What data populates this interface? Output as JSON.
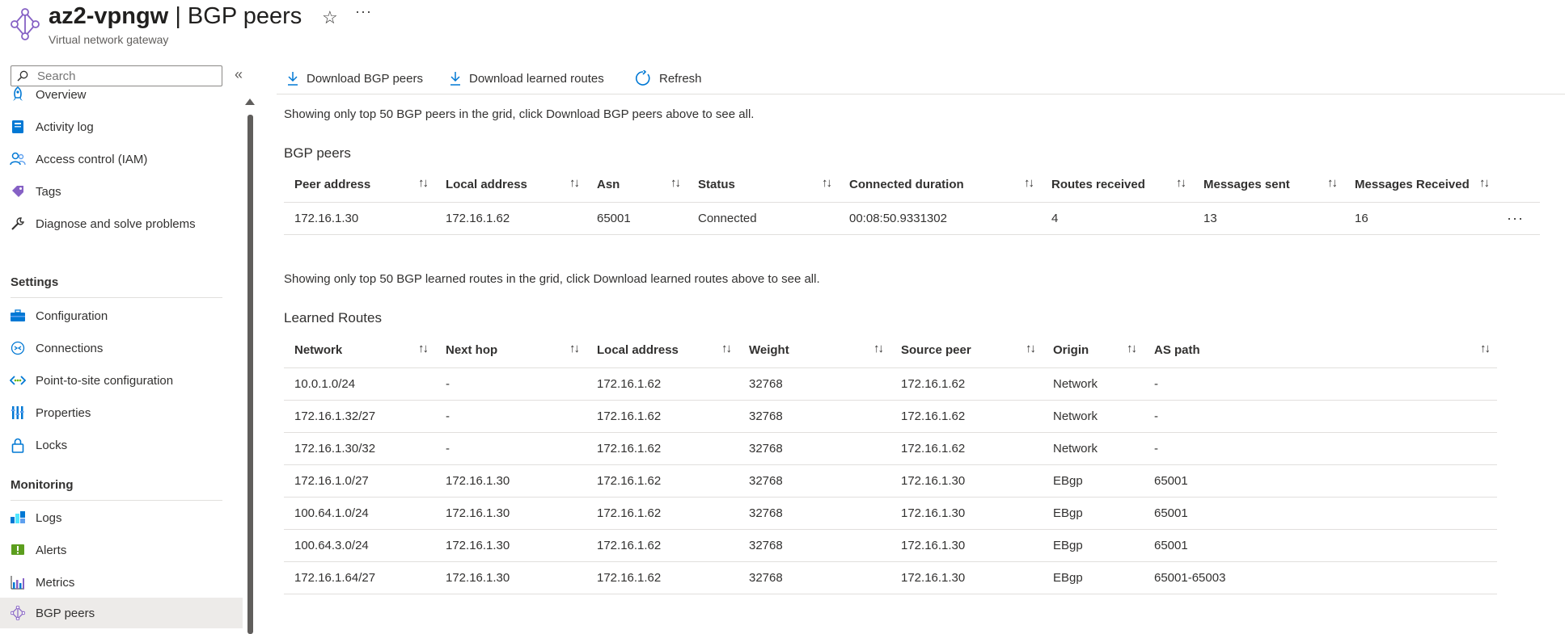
{
  "header": {
    "resource_name": "az2-vpngw",
    "page_name": "BGP peers",
    "separator": "|",
    "subtitle": "Virtual network gateway",
    "favorite_icon": "star-icon",
    "more_label": "···"
  },
  "sidebar": {
    "search_placeholder": "Search",
    "collapse_label": "«",
    "items_top": [
      {
        "label": "Overview",
        "icon": "rocket-icon"
      },
      {
        "label": "Activity log",
        "icon": "log-book-icon"
      },
      {
        "label": "Access control (IAM)",
        "icon": "users-icon"
      },
      {
        "label": "Tags",
        "icon": "tag-icon"
      },
      {
        "label": "Diagnose and solve problems",
        "icon": "wrench-icon"
      }
    ],
    "settings_heading": "Settings",
    "settings_items": [
      {
        "label": "Configuration",
        "icon": "toolbox-icon"
      },
      {
        "label": "Connections",
        "icon": "connections-icon"
      },
      {
        "label": "Point-to-site configuration",
        "icon": "point-to-site-icon"
      },
      {
        "label": "Properties",
        "icon": "properties-icon"
      },
      {
        "label": "Locks",
        "icon": "lock-icon"
      }
    ],
    "monitoring_heading": "Monitoring",
    "monitoring_items": [
      {
        "label": "Logs",
        "icon": "logs-icon"
      },
      {
        "label": "Alerts",
        "icon": "alert-icon"
      },
      {
        "label": "Metrics",
        "icon": "metrics-icon"
      },
      {
        "label": "BGP peers",
        "icon": "bgp-peers-icon",
        "active": true
      }
    ]
  },
  "toolbar": {
    "download_peers": "Download BGP peers",
    "download_routes": "Download learned routes",
    "refresh": "Refresh"
  },
  "peers": {
    "info": "Showing only top 50 BGP peers in the grid, click Download BGP peers above to see all.",
    "title": "BGP peers",
    "columns": [
      "Peer address",
      "Local address",
      "Asn",
      "Status",
      "Connected duration",
      "Routes received",
      "Messages sent",
      "Messages Received"
    ],
    "rows": [
      [
        "172.16.1.30",
        "172.16.1.62",
        "65001",
        "Connected",
        "00:08:50.9331302",
        "4",
        "13",
        "16"
      ]
    ],
    "row_more": "···"
  },
  "routes": {
    "info": "Showing only top 50 BGP learned routes in the grid, click Download learned routes above to see all.",
    "title": "Learned Routes",
    "columns": [
      "Network",
      "Next hop",
      "Local address",
      "Weight",
      "Source peer",
      "Origin",
      "AS path"
    ],
    "rows": [
      [
        "10.0.1.0/24",
        "-",
        "172.16.1.62",
        "32768",
        "172.16.1.62",
        "Network",
        "-"
      ],
      [
        "172.16.1.32/27",
        "-",
        "172.16.1.62",
        "32768",
        "172.16.1.62",
        "Network",
        "-"
      ],
      [
        "172.16.1.30/32",
        "-",
        "172.16.1.62",
        "32768",
        "172.16.1.62",
        "Network",
        "-"
      ],
      [
        "172.16.1.0/27",
        "172.16.1.30",
        "172.16.1.62",
        "32768",
        "172.16.1.30",
        "EBgp",
        "65001"
      ],
      [
        "100.64.1.0/24",
        "172.16.1.30",
        "172.16.1.62",
        "32768",
        "172.16.1.30",
        "EBgp",
        "65001"
      ],
      [
        "100.64.3.0/24",
        "172.16.1.30",
        "172.16.1.62",
        "32768",
        "172.16.1.30",
        "EBgp",
        "65001"
      ],
      [
        "172.16.1.64/27",
        "172.16.1.30",
        "172.16.1.62",
        "32768",
        "172.16.1.30",
        "EBgp",
        "65001-65003"
      ]
    ]
  },
  "colors": {
    "accent": "#0078d4",
    "text": "#323130",
    "muted": "#605e5c",
    "border": "#e1dfdd",
    "active_bg": "#edebe9",
    "bgp_icon": "#8661c5"
  }
}
